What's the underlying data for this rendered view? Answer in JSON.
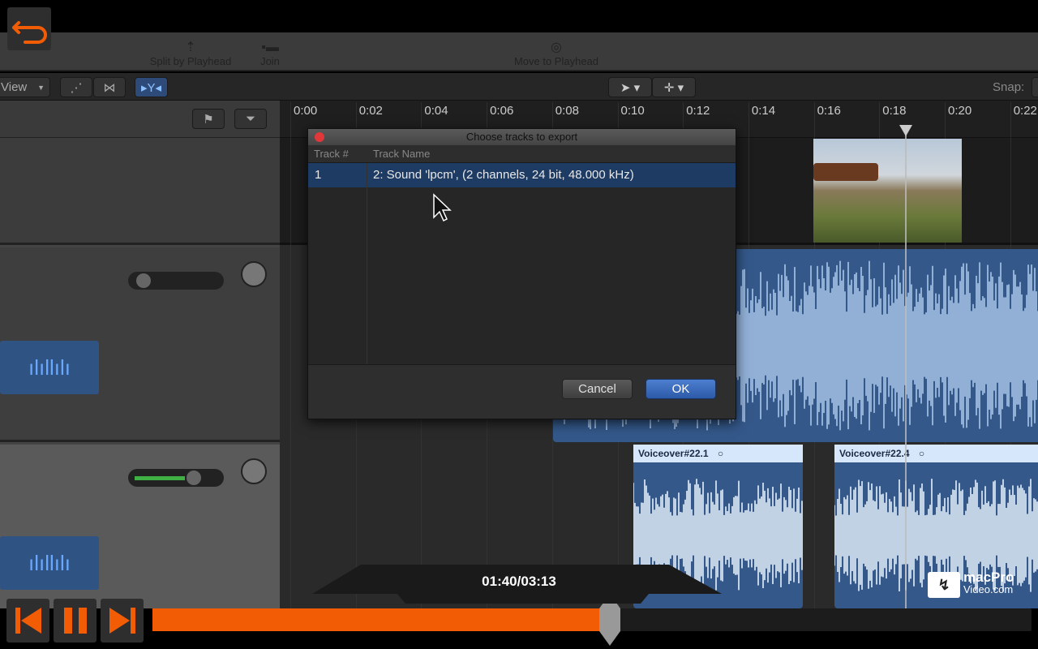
{
  "toolbar": {
    "split": "Split by Playhead",
    "join": "Join",
    "move": "Move to Playhead"
  },
  "bar2": {
    "view": "View",
    "snap": "Snap:"
  },
  "ruler": [
    "0:00",
    "0:02",
    "0:04",
    "0:06",
    "0:08",
    "0:10",
    "0:12",
    "0:14",
    "0:16",
    "0:18",
    "0:20",
    "0:22"
  ],
  "dialog": {
    "title": "Choose tracks to export",
    "col_track": "Track #",
    "col_name": "Track Name",
    "rows": [
      {
        "num": "1",
        "name": "2: Sound 'lpcm', (2 channels, 24 bit, 48.000 kHz)"
      }
    ],
    "cancel": "Cancel",
    "ok": "OK"
  },
  "clips": {
    "vo1": "Voiceover#22.1",
    "vo2": "Voiceover#22.4"
  },
  "player": {
    "time": "01:40/03:13",
    "progress": 0.52,
    "logo_line1": "macPro",
    "logo_line2": "Video.com"
  },
  "colors": {
    "accent": "#f25c05",
    "selection": "#1e3b64",
    "clip": "#34588a"
  }
}
